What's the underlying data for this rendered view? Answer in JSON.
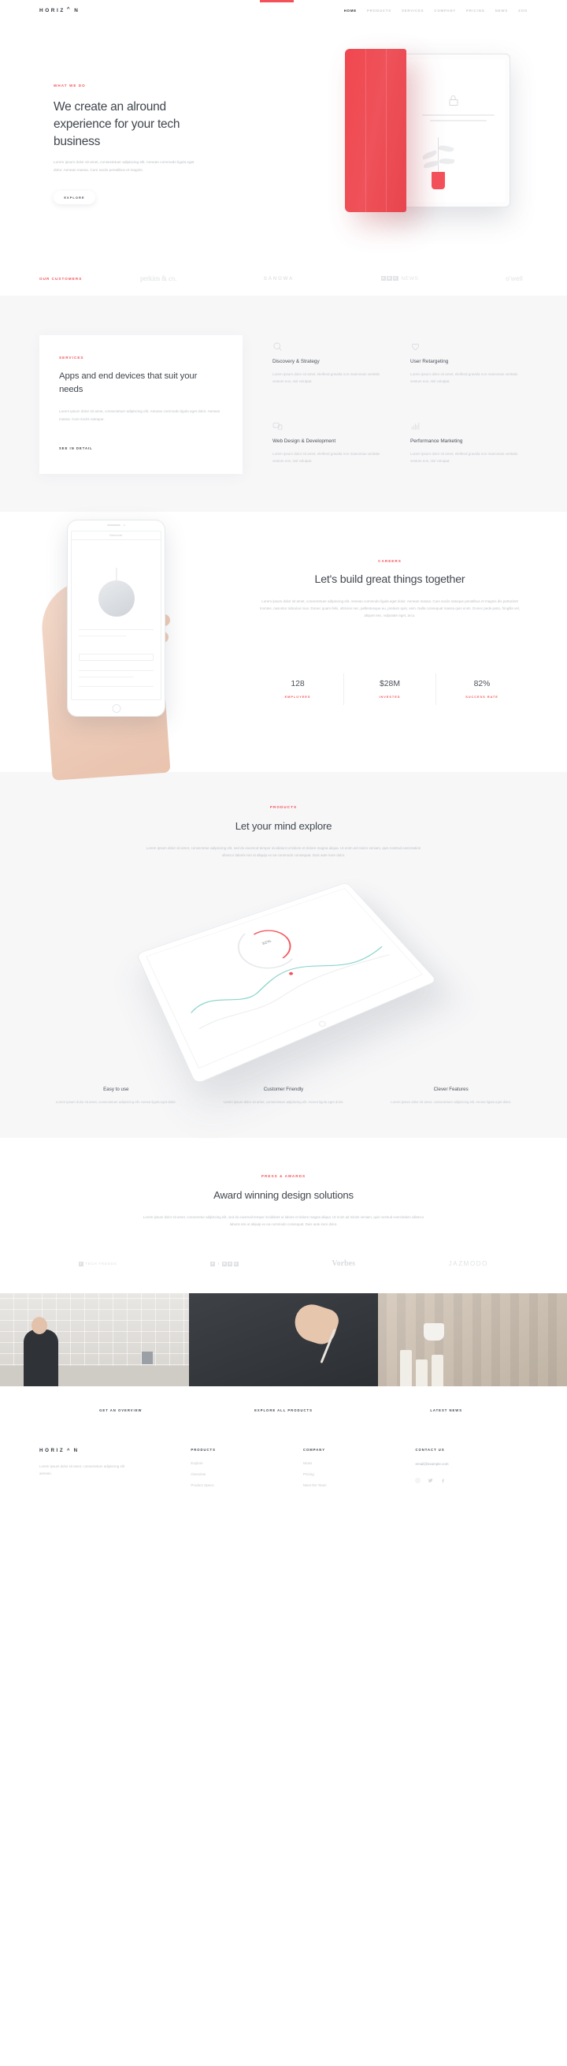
{
  "brand": {
    "name": "HORIZ",
    "caret": "^",
    "name_end": "N"
  },
  "nav": {
    "items": [
      {
        "label": "HOME",
        "active": true
      },
      {
        "label": "PRODUCTS",
        "active": false
      },
      {
        "label": "SERVICES",
        "active": false
      },
      {
        "label": "COMPANY",
        "active": false
      },
      {
        "label": "PRICING",
        "active": false
      },
      {
        "label": "NEWS",
        "active": false
      },
      {
        "label": "ZOO",
        "active": false
      }
    ]
  },
  "hero": {
    "eyebrow": "WHAT WE DO",
    "title": "We create an alround experience for your tech business",
    "description": "Lorem ipsum dolor sit amet, consectetuer adipiscing elit. Aenean commodo ligula eget dolor. Aenean massa. Cum sociis penatibus et magnis.",
    "cta": "EXPLORE"
  },
  "customers": {
    "eyebrow": "OUR CUSTOMERS",
    "logos": [
      "perkins & co.",
      "SANOWA",
      "ABC NEWS",
      "o'well"
    ]
  },
  "services": {
    "card": {
      "eyebrow": "SERVICES",
      "title": "Apps and end devices that suit your needs",
      "description": "Lorem ipsum dolor sit amet, consectetuer adipiscing elit. Aenean commodo ligula eget dolor. Aenean massa. Cum sociis natoque.",
      "link": "SEE IN DETAIL"
    },
    "items": [
      {
        "icon": "search-icon",
        "title": "Discovery & Strategy",
        "text": "Lorem ipsum dolor sit amet, eleifend gravida non maecenas veritatis vestum eos, nisl volutpat."
      },
      {
        "icon": "heart-icon",
        "title": "User Retargeting",
        "text": "Lorem ipsum dolor sit amet, eleifend gravida non maecenas veritatis vestum eos, nisl volutpat."
      },
      {
        "icon": "devices-icon",
        "title": "Web Design & Development",
        "text": "Lorem ipsum dolor sit amet, eleifend gravida non maecenas veritatis vestum eos, nisl volutpat."
      },
      {
        "icon": "bar-chart-icon",
        "title": "Performance Marketing",
        "text": "Lorem ipsum dolor sit amet, eleifend gravida non maecenas veritatis vestum eos, nisl volutpat."
      }
    ]
  },
  "careers": {
    "eyebrow": "CAREERS",
    "title": "Let's build great things together",
    "description": "Lorem ipsum dolor sit amet, consectetuer adipiscing elit. Aenean commodo ligula eget dolor. Aenean massa. Cum sociis natoque penatibus et magnis dis parturient montes, nascetur ridiculus mus. Donec quam felis, ultricies nec, pellentesque eu, pretium quis, sem. Nulla consequat massa quis enim. Donec pede justo, fringilla vel, aliquet nec, vulputate eget, arcu.",
    "phone_app_title": "Discover",
    "phone_tag": "Mobile Speakers",
    "stats": [
      {
        "value": "128",
        "label": "EMPLOYEES"
      },
      {
        "value": "$28M",
        "label": "INVESTED"
      },
      {
        "value": "82%",
        "label": "SUCCESS RATE"
      }
    ]
  },
  "products": {
    "eyebrow": "PRODUCTS",
    "title": "Let your mind explore",
    "description": "Lorem ipsum dolor sit amet, consectetur adipiscing elit, sed do eiusmod tempor incididunt ut labore et dolore magna aliqua. Ut enim ad minim veniam, quis nostrud exercitation ullamco laboris nisi ut aliquip ex ea commodo consequat. Duis aute irure dolor.",
    "gauge_value": "32%",
    "features": [
      {
        "title": "Easy to use",
        "text": "Lorem ipsum dolor sit amet, consectetuer adipiscing elit. Aenea ligula eget dolor."
      },
      {
        "title": "Customer Friendly",
        "text": "Lorem ipsum dolor sit amet, consectetuer adipiscing elit. Aenea ligula eget dolor."
      },
      {
        "title": "Clever Features",
        "text": "Lorem ipsum dolor sit amet, consectetuer adipiscing elit. Aenea ligula eget dolor."
      }
    ]
  },
  "press": {
    "eyebrow": "PRESS & AWARDS",
    "title": "Award winning design solutions",
    "description": "Lorem ipsum dolor sit amet, consectetur adipiscing elit, sed do eiusmod tempor incididunt ut labore et dolore magna aliqua. Ut enim ad minim veniam, quis nostrud exercitation ullamco laboris nisi ut aliquip ex ea commodo consequat. Duis aute irure dolor.",
    "logos": [
      "TECH TRENDS",
      "FIRED",
      "Vorbes",
      "JAZMODO"
    ]
  },
  "cta_strip": [
    {
      "label": "GET AN OVERVIEW"
    },
    {
      "label": "EXPLORE ALL PRODUCTS"
    },
    {
      "label": "LATEST NEWS"
    }
  ],
  "footer": {
    "about": "Lorem ipsum dolor sit amet, consectetuer adipiscing elit aenean.",
    "columns": [
      {
        "heading": "PRODUCTS",
        "links": [
          "Explore",
          "Overview",
          "Product Specs"
        ]
      },
      {
        "heading": "COMPANY",
        "links": [
          "News",
          "Pricing",
          "Meet the Team"
        ]
      }
    ],
    "contact_heading": "CONTACT US",
    "email": "email@example.com",
    "socials": [
      "instagram-icon",
      "twitter-icon",
      "facebook-icon"
    ]
  },
  "colors": {
    "accent": "#f4525b",
    "ink": "#42484f",
    "muted": "#bec2c7",
    "panel": "#f7f7f8"
  }
}
